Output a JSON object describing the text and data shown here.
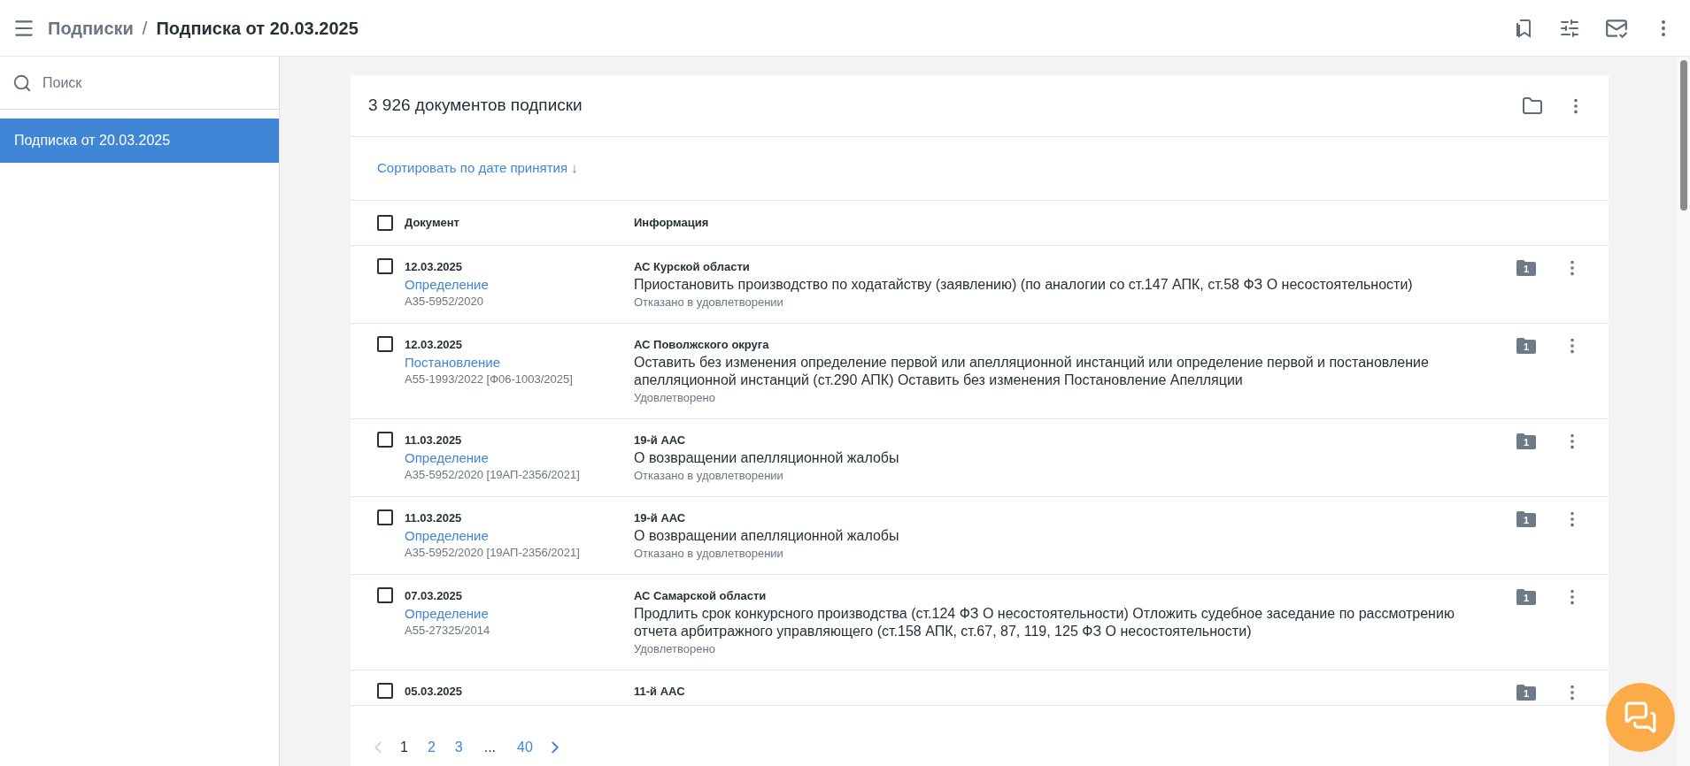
{
  "topbar": {
    "breadcrumb": [
      {
        "label": "Подписки",
        "current": false
      },
      {
        "label": "Подписка от 20.03.2025",
        "current": true
      }
    ],
    "separator": "/"
  },
  "sidebar": {
    "search": {
      "placeholder": "Поиск"
    },
    "items": [
      {
        "label": "Подписка от 20.03.2025",
        "selected": true
      }
    ]
  },
  "card": {
    "title": "3 926 документов подписки",
    "sort_link": "Сортировать по дате принятия ↓",
    "table": {
      "header_checked": false,
      "columns": [
        "Документ",
        "Информация"
      ],
      "rows": [
        {
          "checked": false,
          "date": "12.03.2025",
          "doc_type": "Определение",
          "case_no": "А35-5952/2020",
          "court": "АС Курской области",
          "description": "Приостановить производство по ходатайству (заявлению) (по аналогии со ст.147 АПК, ст.58 ФЗ О несостоятельности)",
          "status": "Отказано в удовлетворении",
          "attachments": "1"
        },
        {
          "checked": false,
          "date": "12.03.2025",
          "doc_type": "Постановление",
          "case_no": "А55-1993/2022 [Ф06-1003/2025]",
          "court": "АС Поволжского округа",
          "description": "Оставить без изменения определение первой или апелляционной инстанций или определение первой и постановление апелляционной инстанций (ст.290 АПК) Оставить без изменения Постановление Апелляции",
          "status": "Удовлетворено",
          "attachments": "1"
        },
        {
          "checked": false,
          "date": "11.03.2025",
          "doc_type": "Определение",
          "case_no": "А35-5952/2020 [19АП-2356/2021]",
          "court": "19-й ААС",
          "description": "О возвращении апелляционной жалобы",
          "status": "Отказано в удовлетворении",
          "attachments": "1"
        },
        {
          "checked": false,
          "date": "11.03.2025",
          "doc_type": "Определение",
          "case_no": "А35-5952/2020 [19АП-2356/2021]",
          "court": "19-й ААС",
          "description": "О возвращении апелляционной жалобы",
          "status": "Отказано в удовлетворении",
          "attachments": "1"
        },
        {
          "checked": false,
          "date": "07.03.2025",
          "doc_type": "Определение",
          "case_no": "А55-27325/2014",
          "court": "АС Самарской области",
          "description": "Продлить срок конкурсного производства (ст.124 ФЗ О несостоятельности) Отложить судебное заседание по рассмотрению отчета арбитражного управляющего (ст.158 АПК, ст.67, 87, 119, 125 ФЗ О несостоятельности)",
          "status": "Удовлетворено",
          "attachments": "1"
        },
        {
          "checked": false,
          "date": "05.03.2025",
          "court": "11-й ААС",
          "attachments": "1"
        }
      ]
    },
    "pagination": {
      "prev_disabled": true,
      "pages": [
        {
          "label": "1",
          "selected": true
        },
        {
          "label": "2",
          "selected": false
        },
        {
          "label": "3",
          "selected": false
        },
        {
          "label": "...",
          "kind": "ellipsis"
        },
        {
          "label": "40",
          "selected": false
        }
      ]
    }
  }
}
